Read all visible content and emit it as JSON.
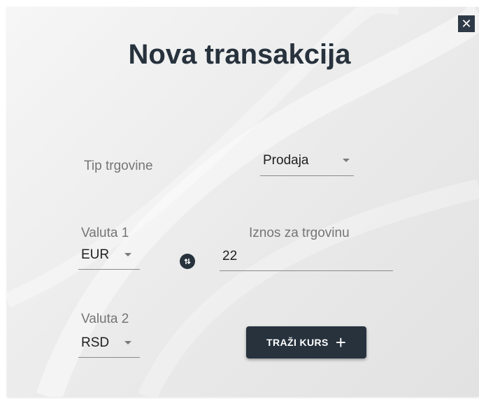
{
  "dialog": {
    "title": "Nova transakcija",
    "close_icon": "close-icon",
    "close_glyph": "✕"
  },
  "trade_type": {
    "label": "Tip trgovine",
    "selected": "Prodaja"
  },
  "currency1": {
    "label": "Valuta 1",
    "selected": "EUR"
  },
  "amount": {
    "label": "Iznos za trgovinu",
    "value": "22"
  },
  "currency2": {
    "label": "Valuta 2",
    "selected": "RSD"
  },
  "swap_icon": "swap-icon",
  "search_button": {
    "label": "TRAŽI KURS",
    "icon": "plus-icon",
    "glyph": "+"
  },
  "colors": {
    "primary": "#27323d",
    "label_text": "#757575",
    "underline": "#8a8a8a"
  }
}
